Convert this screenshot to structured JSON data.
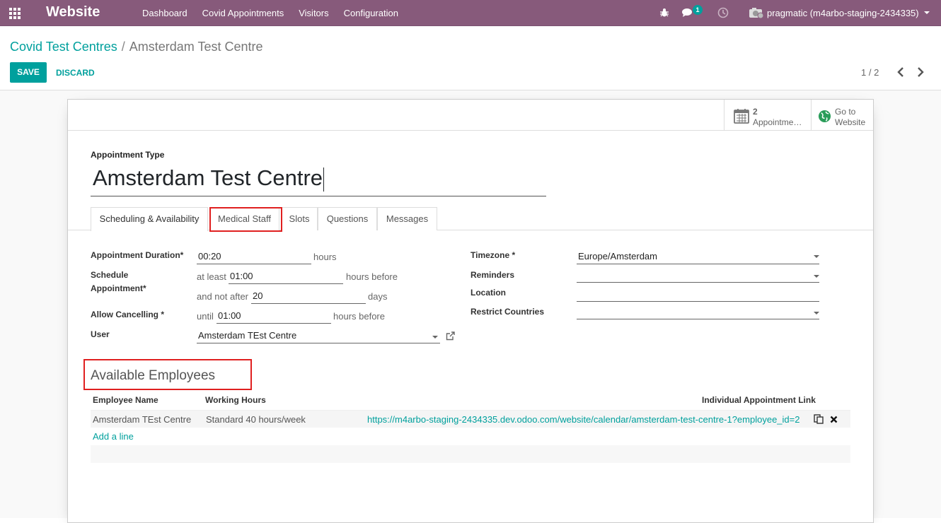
{
  "navbar": {
    "app_title": "Website",
    "menu": [
      "Dashboard",
      "Covid Appointments",
      "Visitors",
      "Configuration"
    ],
    "chat_badge": "1",
    "user": "pragmatic (m4arbo-staging-2434335)"
  },
  "breadcrumb": {
    "parent": "Covid Test Centres",
    "current": "Amsterdam Test Centre"
  },
  "actions": {
    "save": "SAVE",
    "discard": "DISCARD"
  },
  "pager": {
    "value": "1 / 2"
  },
  "stat_buttons": {
    "appointments": {
      "count": "2",
      "label": "Appointme…"
    },
    "website": {
      "line1": "Go to",
      "line2": "Website"
    }
  },
  "form": {
    "type_label": "Appointment Type",
    "name": "Amsterdam Test Centre",
    "tabs": [
      "Scheduling & Availability",
      "Medical Staff",
      "Slots",
      "Questions",
      "Messages"
    ],
    "duration": {
      "label": "Appointment Duration*",
      "value": "00:20",
      "unit": "hours"
    },
    "schedule": {
      "label1": "Schedule",
      "label2": "Appointment*",
      "at_least": "at least",
      "min_value": "01:00",
      "min_unit": "hours before",
      "not_after": "and not after",
      "max_value": "20",
      "max_unit": "days"
    },
    "cancel": {
      "label": "Allow Cancelling *",
      "until": "until",
      "value": "01:00",
      "unit": "hours before"
    },
    "user": {
      "label": "User",
      "value": "Amsterdam TEst Centre"
    },
    "timezone": {
      "label": "Timezone *",
      "value": "Europe/Amsterdam"
    },
    "reminders": {
      "label": "Reminders",
      "value": ""
    },
    "location": {
      "label": "Location",
      "value": ""
    },
    "countries": {
      "label": "Restrict Countries",
      "value": ""
    }
  },
  "employees": {
    "title": "Available Employees",
    "columns": [
      "Employee Name",
      "Working Hours",
      "Individual Appointment Link"
    ],
    "rows": [
      {
        "name": "Amsterdam TEst Centre",
        "hours": "Standard 40 hours/week",
        "link": "https://m4arbo-staging-2434335.dev.odoo.com/website/calendar/amsterdam-test-centre-1?employee_id=2"
      }
    ],
    "add_line": "Add a line"
  },
  "colors": {
    "navbar": "#875a7b",
    "accent": "#00a09d",
    "highlight": "#e02020"
  }
}
